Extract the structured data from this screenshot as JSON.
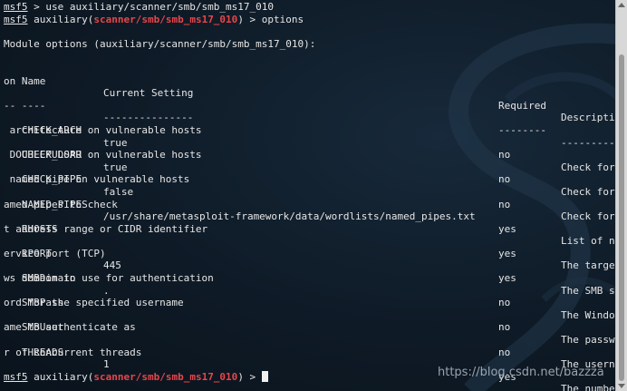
{
  "session": {
    "prompt_name": "msf5",
    "line1_rest": " > use auxiliary/scanner/smb/smb_ms17_010",
    "module_prefix": " auxiliary(",
    "module_path": "scanner/smb/smb_ms17_010",
    "module_suffix": ")",
    "line2_cmd": " > options",
    "final_prompt_suffix": " > "
  },
  "options": {
    "heading": "Module options (auxiliary/scanner/smb/smb_ms17_010):",
    "headers": {
      "name": "   Name",
      "setting": "Current Setting",
      "required": "Required",
      "description": "Descripti",
      "wrap": "on"
    },
    "underline": {
      "name": "   ----",
      "setting": "---------------",
      "required": "--------",
      "description": "----------",
      "wrap": "--"
    },
    "rows": [
      {
        "name": "   CHECK_ARCH",
        "setting": "true",
        "required": "no",
        "desc": "Check for",
        "wrap": " architecture on vulnerable hosts"
      },
      {
        "name": "   CHECK_DOPU",
        "setting": "true",
        "required": "no",
        "desc": "Check for",
        "wrap": " DOUBLEPULSAR on vulnerable hosts"
      },
      {
        "name": "   CHECK_PIPE",
        "setting": "false",
        "required": "no",
        "desc": "Check for",
        "wrap": " named pipe on vulnerable hosts"
      },
      {
        "name": "   NAMED_PIPES",
        "setting": "/usr/share/metasploit-framework/data/wordlists/named_pipes.txt",
        "required": "yes",
        "desc": "List of n",
        "wrap": "amed pipes to check"
      },
      {
        "name": "   RHOSTS",
        "setting": "",
        "required": "yes",
        "desc": "The targe",
        "wrap": "t address range or CIDR identifier"
      },
      {
        "name": "   RPORT",
        "setting": "445",
        "required": "yes",
        "desc": "The SMB s",
        "wrap": "ervice port (TCP)"
      },
      {
        "name": "   SMBDomain",
        "setting": ".",
        "required": "no",
        "desc": "The Windo",
        "wrap": "ws domain to use for authentication"
      },
      {
        "name": "   SMBPass",
        "setting": "",
        "required": "no",
        "desc": "The passw",
        "wrap": "ord for the specified username"
      },
      {
        "name": "   SMBUser",
        "setting": "",
        "required": "no",
        "desc": "The usern",
        "wrap": "ame to authenticate as"
      },
      {
        "name": "   THREADS",
        "setting": "1",
        "required": "yes",
        "desc": "The numbe",
        "wrap": "r of concurrent threads"
      }
    ]
  },
  "watermark": "https://blog.csdn.net/bazzza",
  "colors": {
    "background": "#0e1a26",
    "text": "#e6e6e6",
    "module_path": "#e8454a"
  }
}
